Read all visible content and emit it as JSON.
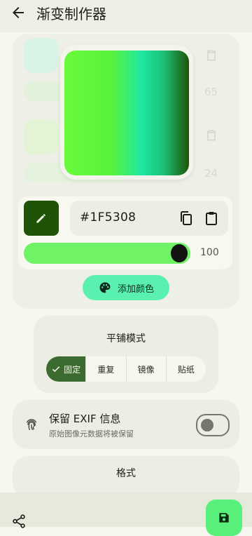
{
  "appbar": {
    "title": "渐变制作器"
  },
  "background_items": {
    "value_1": "65",
    "value_2": "24"
  },
  "color_stop": {
    "hex": "#1F5308",
    "swatch_color": "#1F5308",
    "position_value": "100",
    "position_fraction": 1.0
  },
  "preview": {
    "gradient_colors": [
      "#68FB3A",
      "#1DE8A1",
      "#1F5308"
    ]
  },
  "add_color": {
    "label": "添加颜色"
  },
  "tile_mode": {
    "title": "平铺模式",
    "options": [
      {
        "label": "固定",
        "selected": true
      },
      {
        "label": "重复",
        "selected": false
      },
      {
        "label": "镜像",
        "selected": false
      },
      {
        "label": "贴纸",
        "selected": false
      }
    ]
  },
  "exif": {
    "title": "保留 EXIF 信息",
    "subtitle": "原始图像元数据将被保留",
    "enabled": false
  },
  "format": {
    "title": "格式"
  },
  "colors": {
    "accent": "#3C6B2F",
    "button_bg": "#5AF0B0",
    "fab_bg": "#5AF07C"
  },
  "icons": [
    "back-arrow-icon",
    "pencil-icon",
    "copy-icon",
    "paste-icon",
    "palette-icon",
    "check-icon",
    "fingerprint-icon",
    "share-icon",
    "save-icon"
  ]
}
